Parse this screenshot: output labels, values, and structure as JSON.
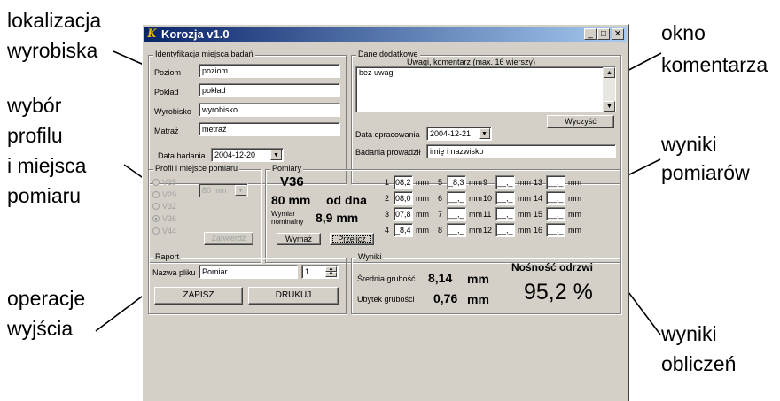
{
  "annotations": {
    "lokalizacja": "lokalizacja",
    "wyrobiska": "wyrobiska",
    "wybor": "wybór",
    "profilu": "profilu",
    "i_miejsca": "i miejsca",
    "pomiaru": "pomiaru",
    "okno": "okno",
    "komentarza": "komentarza",
    "wyniki1": "wyniki",
    "pomiarow": "pomiarów",
    "operacje": "operacje",
    "wyjscia": "wyjścia",
    "wyniki2": "wyniki",
    "obliczen": "obliczeń"
  },
  "window": {
    "title": "Korozja v1.0",
    "minimize": "_",
    "maximize": "□",
    "close": "✕"
  },
  "identification": {
    "title": "Identyfikacja miejsca badań",
    "poziom_label": "Poziom",
    "poziom_value": "poziom",
    "poklad_label": "Pokład",
    "poklad_value": "pokład",
    "wyrobisko_label": "Wyrobisko",
    "wyrobisko_value": "wyrobisko",
    "matraz_label": "Matraż",
    "matraz_value": "metraż",
    "date_label": "Data badania",
    "date_value": "2004-12-20"
  },
  "extra": {
    "title": "Dane dodatkowe",
    "comment_label": "Uwagi, komentarz (max. 16 wierszy)",
    "comment_value": "bez uwag",
    "clear_button": "Wyczyść",
    "date_label": "Data opracowania",
    "date_value": "2004-12-21",
    "person_label": "Badania prowadził",
    "person_value": "imię i nazwisko"
  },
  "profile": {
    "title": "Profil i miejsce pomiaru",
    "options": [
      "V25",
      "V29",
      "V32",
      "V36",
      "V44"
    ],
    "selected": "V36",
    "position_value": "80 mm",
    "confirm_button": "Zatwierdź"
  },
  "measurements": {
    "title": "Pomiary",
    "profile": "V36",
    "distance": "80 mm",
    "distance_suffix": "od dna",
    "nominal_label1": "Wymiar",
    "nominal_label2": "nominalny",
    "nominal_value": "8,9 mm",
    "clear_button": "Wymaż",
    "recalc_button": "Przelicz",
    "unit": "mm",
    "cells": [
      {
        "n": "1",
        "v": "08,2"
      },
      {
        "n": "2",
        "v": "08,0"
      },
      {
        "n": "3",
        "v": "07,8"
      },
      {
        "n": "4",
        "v": "_8,4"
      },
      {
        "n": "5",
        "v": "_8,3"
      },
      {
        "n": "6",
        "v": "__,_"
      },
      {
        "n": "7",
        "v": "__,_"
      },
      {
        "n": "8",
        "v": "__,_"
      },
      {
        "n": "9",
        "v": "__,_"
      },
      {
        "n": "10",
        "v": "__,_"
      },
      {
        "n": "11",
        "v": "__,_"
      },
      {
        "n": "12",
        "v": "__,_"
      },
      {
        "n": "13",
        "v": "__,_"
      },
      {
        "n": "14",
        "v": "__,_"
      },
      {
        "n": "15",
        "v": "__,_"
      },
      {
        "n": "16",
        "v": "__,_"
      }
    ]
  },
  "report": {
    "title": "Raport",
    "filename_label": "Nazwa pliku",
    "filename_value": "Pomiar",
    "number_value": "1",
    "save_button": "ZAPISZ",
    "print_button": "DRUKUJ"
  },
  "results": {
    "title": "Wyniki",
    "avg_label": "Średnia grubość",
    "avg_value": "8,14",
    "avg_unit": "mm",
    "loss_label": "Ubytek grubości",
    "loss_value": "0,76",
    "loss_unit": "mm",
    "capacity_label": "Nośność odrzwi",
    "capacity_value": "95,2 %"
  }
}
